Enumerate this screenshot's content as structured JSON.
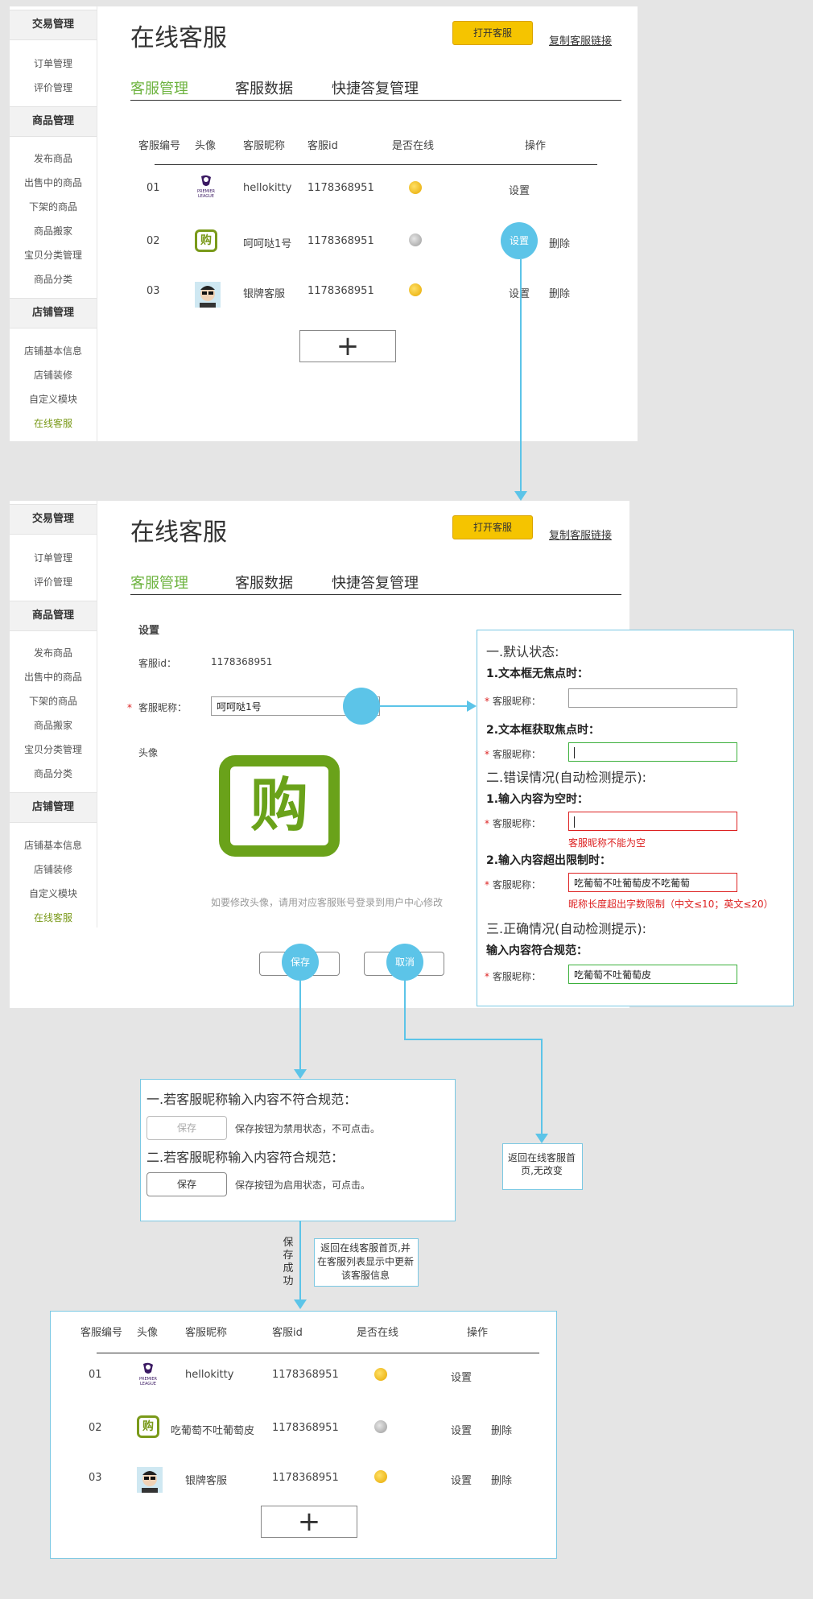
{
  "sidebar": {
    "groups": [
      "交易管理",
      "商品管理",
      "店铺管理"
    ],
    "trade_items": [
      "订单管理",
      "评价管理"
    ],
    "goods_items": [
      "发布商品",
      "出售中的商品",
      "下架的商品",
      "商品搬家",
      "宝贝分类管理",
      "商品分类"
    ],
    "shop_items": [
      "店铺基本信息",
      "店铺装修",
      "自定义模块",
      "在线客服"
    ]
  },
  "page": {
    "title": "在线客服",
    "open_button": "打开客服",
    "copy_link": "复制客服链接",
    "tabs": [
      "客服管理",
      "客服数据",
      "快捷答复管理"
    ]
  },
  "table": {
    "headers": [
      "客服编号",
      "头像",
      "客服昵称",
      "客服id",
      "是否在线",
      "操作"
    ],
    "rows": [
      {
        "no": "01",
        "nick": "hellokitty",
        "id": "1178368951",
        "online": true,
        "ops": [
          "设置"
        ]
      },
      {
        "no": "02",
        "nick": "呵呵哒1号",
        "id": "1178368951",
        "online": false,
        "ops": [
          "设置",
          "删除"
        ]
      },
      {
        "no": "03",
        "nick": "银牌客服",
        "id": "1178368951",
        "online": true,
        "ops": [
          "设置",
          "删除"
        ]
      }
    ],
    "add": "+"
  },
  "settings": {
    "heading": "设置",
    "id_label": "客服id：",
    "id_value": "1178368951",
    "nick_label": "客服昵称：",
    "nick_value": "呵呵哒1号",
    "avatar_label": "头像",
    "avatar_hint": "如要修改头像，请用对应客服账号登录到用户中心修改",
    "save": "保存",
    "cancel": "取消",
    "avatar_glyph": "购"
  },
  "states_note": {
    "h1": "一.默认状态:",
    "b1": "1.文本框无焦点时：",
    "b2": "2.文本框获取焦点时：",
    "h2": "二.错误情况(自动检测提示):",
    "b3": "1.输入内容为空时：",
    "err_empty": "客服昵称不能为空",
    "b4": "2.输入内容超出限制时：",
    "over_value": "吃葡萄不吐葡萄皮不吃葡萄",
    "err_over": "昵称长度超出字数限制（中文≤10；英文≤20）",
    "h3": "三.正确情况(自动检测提示):",
    "b5": "输入内容符合规范：",
    "ok_value": "吃葡萄不吐葡萄皮",
    "label": "客服昵称："
  },
  "save_note": {
    "h1": "一.若客服昵称输入内容不符合规范：",
    "d1": "保存按钮为禁用状态，不可点击。",
    "h2": "二.若客服昵称输入内容符合规范：",
    "d2": "保存按钮为启用状态，可点击。",
    "btn": "保存"
  },
  "cancel_note": "返回在线客服首页,无改变",
  "save_success": [
    "保",
    "存",
    "成",
    "功"
  ],
  "return_note": "返回在线客服首页,并在客服列表显示中更新该客服信息",
  "result_table": {
    "rows": [
      {
        "no": "01",
        "nick": "hellokitty",
        "id": "1178368951",
        "online": true,
        "ops": [
          "设置"
        ]
      },
      {
        "no": "02",
        "nick": "吃葡萄不吐葡萄皮",
        "id": "1178368951",
        "online": false,
        "ops": [
          "设置",
          "删除"
        ]
      },
      {
        "no": "03",
        "nick": "银牌客服",
        "id": "1178368951",
        "online": true,
        "ops": [
          "设置",
          "删除"
        ]
      }
    ]
  },
  "colors": {
    "accent": "#6db33f",
    "connector": "#5cc4e8",
    "button": "#f5c400",
    "error": "#d22222"
  }
}
